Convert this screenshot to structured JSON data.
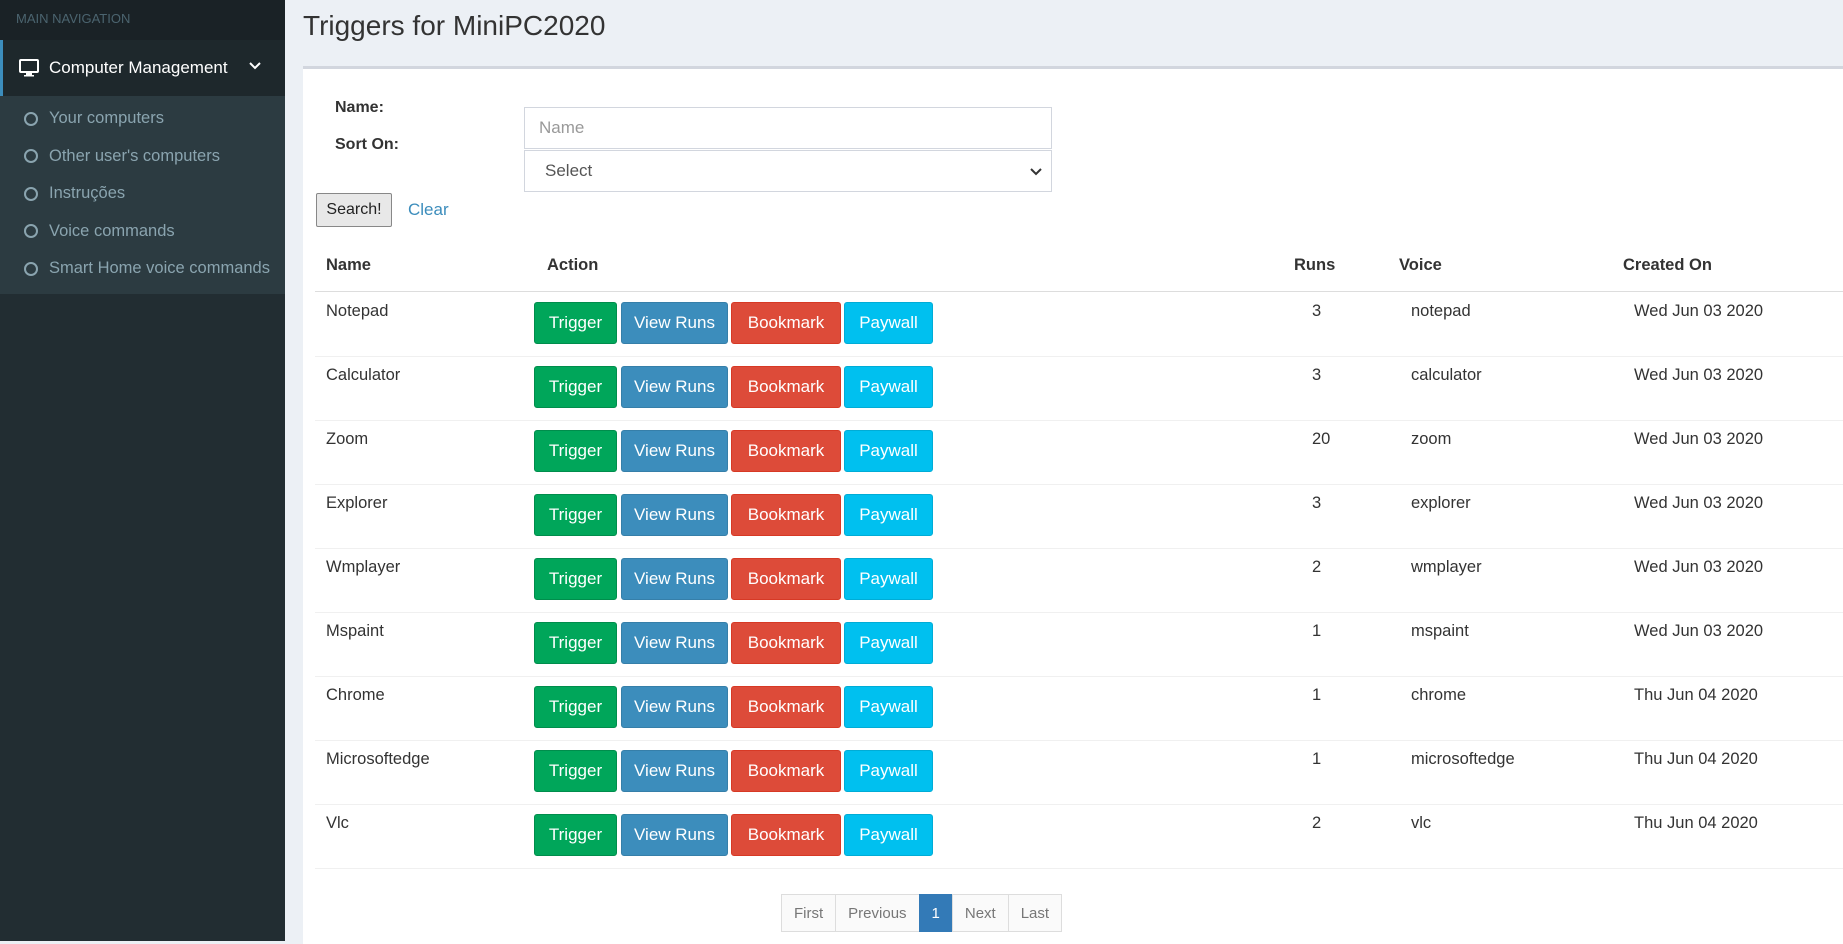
{
  "sidebar": {
    "header": "MAIN NAVIGATION",
    "parent": {
      "label": "Computer Management",
      "icon": "monitor-icon"
    },
    "items": [
      {
        "label": "Your computers"
      },
      {
        "label": "Other user's computers"
      },
      {
        "label": "Instruções"
      },
      {
        "label": "Voice commands"
      },
      {
        "label": "Smart Home voice commands"
      }
    ]
  },
  "page": {
    "title": "Triggers for MiniPC2020"
  },
  "filter": {
    "name_label": "Name:",
    "name_placeholder": "Name",
    "sort_label": "Sort On:",
    "sort_value": "Select",
    "search_label": "Search!",
    "clear_label": "Clear"
  },
  "table": {
    "headers": {
      "name": "Name",
      "action": "Action",
      "runs": "Runs",
      "voice": "Voice",
      "created": "Created On"
    },
    "actions": {
      "trigger": "Trigger",
      "view_runs": "View Runs",
      "bookmark": "Bookmark",
      "paywall": "Paywall"
    },
    "rows": [
      {
        "name": "Notepad",
        "runs": "3",
        "voice": "notepad",
        "created": "Wed Jun 03 2020"
      },
      {
        "name": "Calculator",
        "runs": "3",
        "voice": "calculator",
        "created": "Wed Jun 03 2020"
      },
      {
        "name": "Zoom",
        "runs": "20",
        "voice": "zoom",
        "created": "Wed Jun 03 2020"
      },
      {
        "name": "Explorer",
        "runs": "3",
        "voice": "explorer",
        "created": "Wed Jun 03 2020"
      },
      {
        "name": "Wmplayer",
        "runs": "2",
        "voice": "wmplayer",
        "created": "Wed Jun 03 2020"
      },
      {
        "name": "Mspaint",
        "runs": "1",
        "voice": "mspaint",
        "created": "Wed Jun 03 2020"
      },
      {
        "name": "Chrome",
        "runs": "1",
        "voice": "chrome",
        "created": "Thu Jun 04 2020"
      },
      {
        "name": "Microsoftedge",
        "runs": "1",
        "voice": "microsoftedge",
        "created": "Thu Jun 04 2020"
      },
      {
        "name": "Vlc",
        "runs": "2",
        "voice": "vlc",
        "created": "Thu Jun 04 2020"
      }
    ]
  },
  "pagination": {
    "first": "First",
    "previous": "Previous",
    "current": "1",
    "next": "Next",
    "last": "Last"
  },
  "colors": {
    "sidebar_bg": "#222d32",
    "trigger": "#00a65a",
    "view_runs": "#3c8dbc",
    "bookmark": "#dd4b39",
    "paywall": "#00c0ef",
    "pager_active": "#337ab7"
  }
}
